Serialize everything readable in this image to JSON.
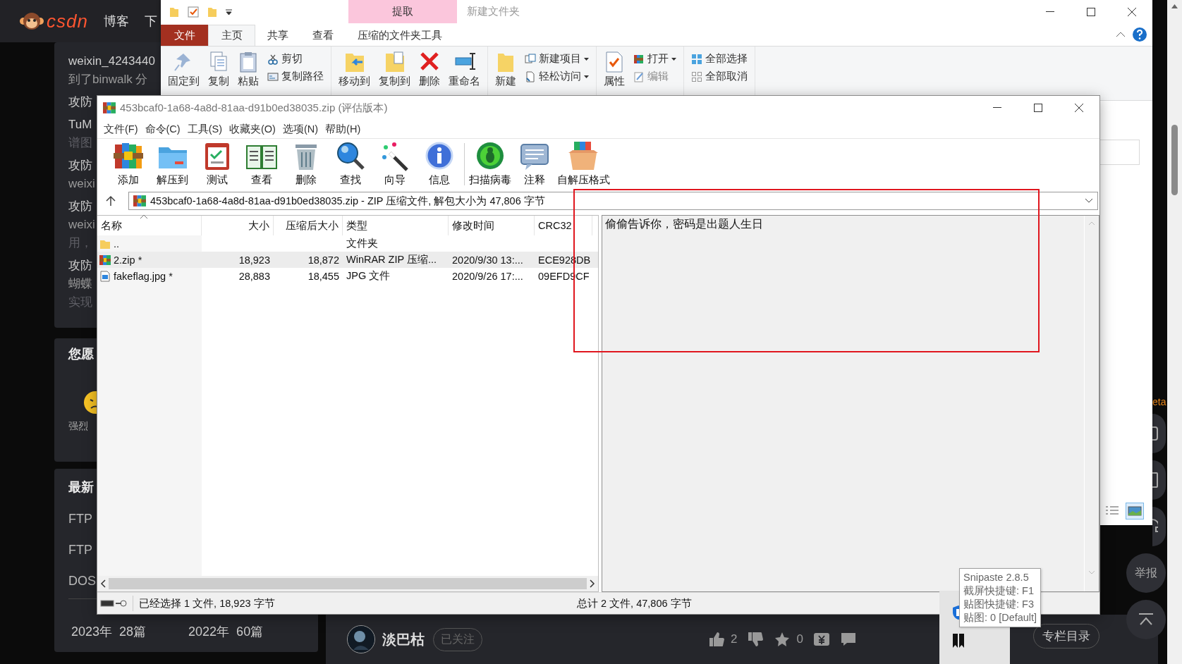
{
  "csdn": {
    "logo": "csdn",
    "nav": [
      "博客",
      "下"
    ],
    "card_lines": [
      {
        "kind": "title",
        "text": "weixin_4243440"
      },
      {
        "kind": "body",
        "text": "到了binwalk 分"
      },
      {
        "kind": "title",
        "text": "攻防"
      },
      {
        "kind": "title",
        "text": "TuM"
      },
      {
        "kind": "muted",
        "text": "谱图"
      },
      {
        "kind": "title",
        "text": "攻防"
      },
      {
        "kind": "body",
        "text": "weixi"
      },
      {
        "kind": "title",
        "text": "攻防"
      },
      {
        "kind": "body",
        "text": "weixi"
      },
      {
        "kind": "muted",
        "text": "用，"
      },
      {
        "kind": "title",
        "text": "攻防"
      },
      {
        "kind": "body",
        "text": "蝴蝶"
      },
      {
        "kind": "muted",
        "text": "实现"
      }
    ],
    "rating_card": {
      "heading": "您愿",
      "label": "强烈"
    },
    "latest_card": {
      "heading": "最新",
      "items": [
        "FTP",
        "FTP",
        "DOS"
      ],
      "archive": [
        "2023年  28篇",
        "2022年  60篇"
      ]
    },
    "author": {
      "name": "淡巴枯",
      "follow": "已关注"
    },
    "actions": [
      {
        "kind": "like",
        "count": "2"
      },
      {
        "kind": "dislike"
      },
      {
        "kind": "favorite",
        "count": "0"
      },
      {
        "kind": "reward"
      },
      {
        "kind": "comment"
      }
    ],
    "column_button": "专栏目录",
    "side_tag": "eta",
    "side_buttons": [
      {
        "kind": "app"
      },
      {
        "kind": "tablet"
      },
      {
        "kind": "headset"
      },
      {
        "kind": "text",
        "label": "举报"
      },
      {
        "kind": "top"
      }
    ]
  },
  "explorer": {
    "title": "新建文件夹",
    "context_header": "提取",
    "tabs": [
      {
        "label": "文件",
        "kind": "file",
        "selected": false
      },
      {
        "label": "主页",
        "kind": "normal",
        "selected": true
      },
      {
        "label": "共享",
        "kind": "normal",
        "selected": false
      },
      {
        "label": "查看",
        "kind": "normal",
        "selected": false
      },
      {
        "label": "压缩的文件夹工具",
        "kind": "contextual",
        "selected": false
      }
    ],
    "groups": [
      [
        {
          "kind": "big",
          "label": "固定到"
        },
        {
          "kind": "big",
          "label": "复制"
        },
        {
          "kind": "big",
          "label": "粘贴"
        },
        {
          "kind": "small",
          "items": [
            {
              "label": "剪切",
              "menu": false,
              "disabled": false
            },
            {
              "label": "复制路径",
              "menu": false,
              "disabled": false
            }
          ]
        }
      ],
      [
        {
          "kind": "big",
          "label": "移动到"
        },
        {
          "kind": "big",
          "label": "复制到"
        },
        {
          "kind": "big",
          "label": "删除"
        },
        {
          "kind": "big",
          "label": "重命名"
        }
      ],
      [
        {
          "kind": "big",
          "label": "新建"
        },
        {
          "kind": "small",
          "items": [
            {
              "label": "新建项目",
              "menu": true,
              "disabled": false
            },
            {
              "label": "轻松访问",
              "menu": true,
              "disabled": false
            }
          ]
        }
      ],
      [
        {
          "kind": "big",
          "label": "属性"
        },
        {
          "kind": "small",
          "items": [
            {
              "label": "打开",
              "menu": true,
              "disabled": false
            },
            {
              "label": "编辑",
              "menu": false,
              "disabled": true
            }
          ]
        }
      ],
      [
        {
          "kind": "small",
          "items": [
            {
              "label": "全部选择",
              "menu": false,
              "disabled": false
            },
            {
              "label": "全部取消",
              "menu": false,
              "disabled": false
            }
          ]
        }
      ]
    ],
    "view_buttons": [
      {
        "selected": false
      },
      {
        "selected": true
      }
    ]
  },
  "winrar": {
    "title": "453bcaf0-1a68-4a8d-81aa-d91b0ed38035.zip (评估版本)",
    "menu": [
      "文件(F)",
      "命令(C)",
      "工具(S)",
      "收藏夹(O)",
      "选项(N)",
      "帮助(H)"
    ],
    "toolbar": [
      "添加",
      "解压到",
      "测试",
      "查看",
      "删除",
      "查找",
      "向导",
      "信息",
      "扫描病毒",
      "注释",
      "自解压格式"
    ],
    "address": "453bcaf0-1a68-4a8d-81aa-d91b0ed38035.zip - ZIP 压缩文件, 解包大小为 47,806 字节",
    "columns": [
      "名称",
      "大小",
      "压缩后大小",
      "类型",
      "修改时间",
      "CRC32"
    ],
    "rows": [
      {
        "kind": "parent",
        "name": "..",
        "size": "",
        "packed": "",
        "type": "文件夹",
        "modified": "",
        "crc": "",
        "selected": false
      },
      {
        "kind": "archive",
        "name": "2.zip *",
        "size": "18,923",
        "packed": "18,872",
        "type": "WinRAR ZIP 压缩...",
        "modified": "2020/9/30 13:...",
        "crc": "ECE928DB",
        "selected": true
      },
      {
        "kind": "image",
        "name": "fakeflag.jpg *",
        "size": "28,883",
        "packed": "18,455",
        "type": "JPG 文件",
        "modified": "2020/9/26 17:...",
        "crc": "09EFD9CF",
        "selected": false
      }
    ],
    "comment": "偷偷告诉你，密码是出题人生日",
    "status_left": "已经选择 1 文件, 18,923 字节",
    "status_right": "总计 2 文件, 47,806 字节"
  },
  "tooltip": {
    "lines": [
      "Snipaste 2.8.5",
      "截屏快捷键: F1",
      "贴图快捷键: F3",
      "贴图: 0 [Default]"
    ]
  }
}
